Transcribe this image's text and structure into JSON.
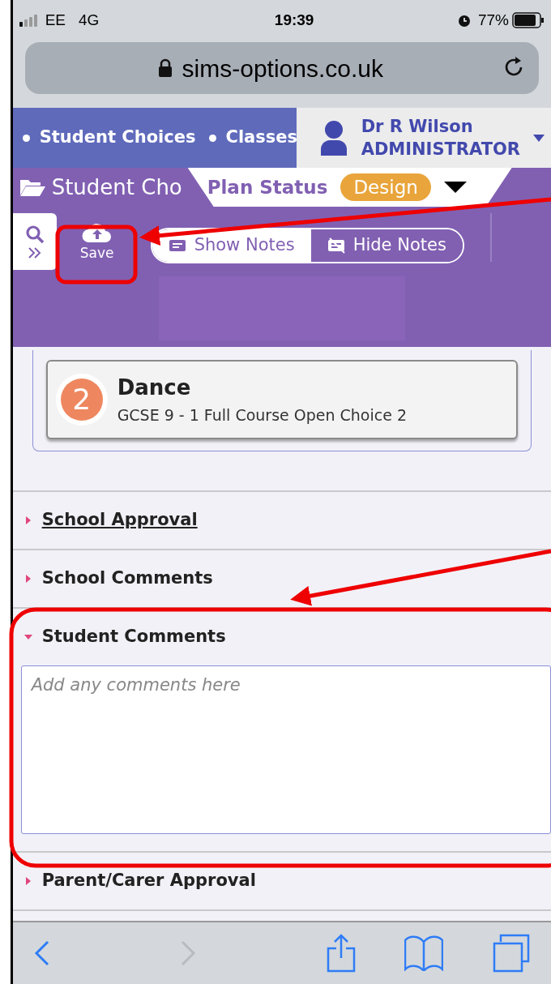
{
  "status_bar": {
    "carrier": "EE",
    "network": "4G",
    "time": "19:39",
    "battery": "77%"
  },
  "address_bar": {
    "url": "sims-options.co.uk"
  },
  "nav": {
    "items": [
      "Student Choices",
      "Classes"
    ],
    "user_name": "Dr R Wilson",
    "user_role": "ADMINISTRATOR"
  },
  "page_header": {
    "title": "Student Cho",
    "plan_status_label": "Plan Status",
    "plan_status": "Design"
  },
  "toolbar": {
    "save": "Save",
    "notes_toggle": [
      {
        "label": "Show Notes",
        "selected": false
      },
      {
        "label": "Hide Notes",
        "selected": true
      }
    ]
  },
  "choice_card": {
    "rank": "2",
    "subject": "Dance",
    "course": "GCSE 9 - 1 Full Course Open Choice 2"
  },
  "sections": [
    {
      "title": "School Approval",
      "underlined": true,
      "expanded": false
    },
    {
      "title": "School Comments",
      "underlined": false,
      "expanded": false
    },
    {
      "title": "Student Comments",
      "underlined": false,
      "expanded": true,
      "placeholder": "Add any comments here"
    },
    {
      "title": "Parent/Carer Approval",
      "underlined": false,
      "expanded": false
    }
  ]
}
